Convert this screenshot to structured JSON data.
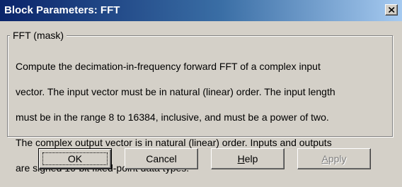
{
  "window": {
    "title": "Block Parameters: FFT",
    "close_glyph": "×"
  },
  "group": {
    "legend": "FFT (mask)",
    "description_lines": [
      "Compute the decimation-in-frequency forward FFT of a complex input",
      "vector. The input vector must be in natural (linear) order. The input length",
      "must be in the range 8 to 16384, inclusive, and must be a power of two.",
      "The complex output vector is in natural (linear) order. Inputs and outputs",
      "are signed 16-bit fixed-point data types."
    ]
  },
  "buttons": {
    "ok": {
      "mnemonic": "",
      "rest": "OK"
    },
    "cancel": {
      "label": "Cancel"
    },
    "help": {
      "mnemonic": "H",
      "rest": "elp"
    },
    "apply": {
      "mnemonic": "A",
      "rest": "pply",
      "disabled": true
    }
  }
}
